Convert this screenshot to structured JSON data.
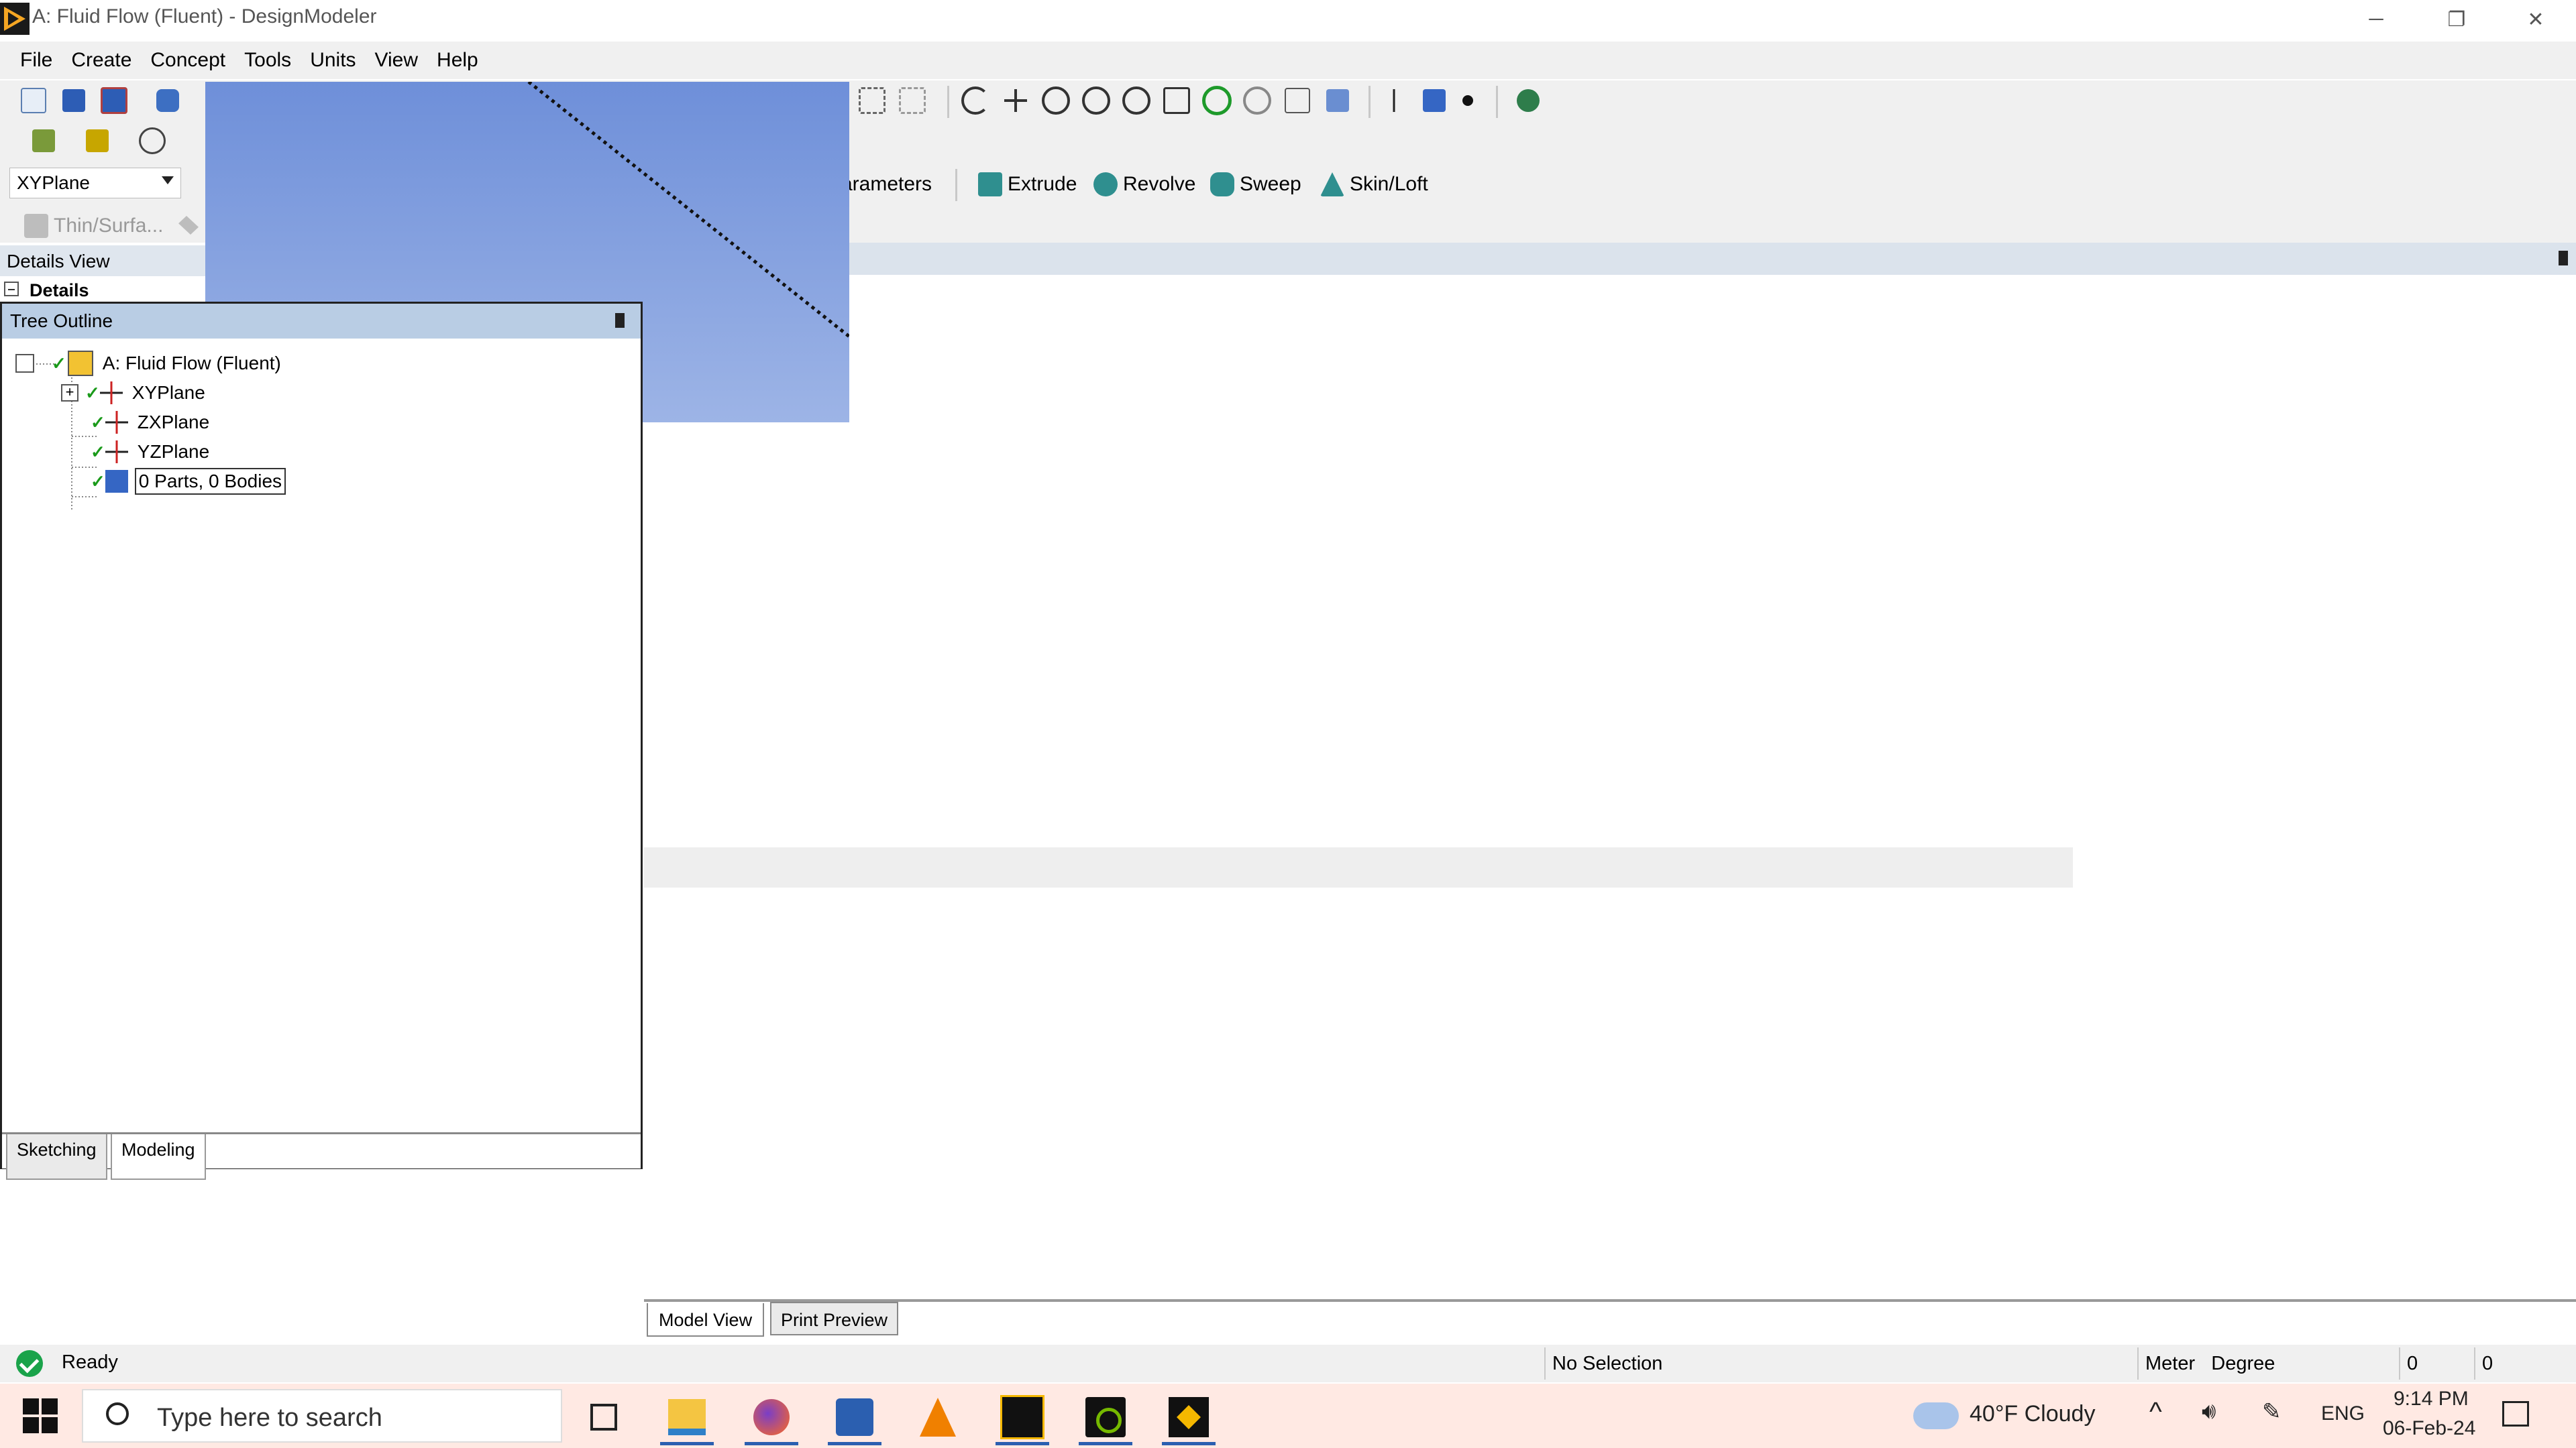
{
  "window": {
    "title": "A: Fluid Flow (Fluent) - DesignModeler",
    "minimize": "─",
    "restore": "❐",
    "close": "✕"
  },
  "menu": [
    "File",
    "Create",
    "Concept",
    "Tools",
    "Units",
    "View",
    "Help"
  ],
  "toolbar": {
    "plane_select": "XYPlane",
    "parameters_label": "arameters",
    "features": [
      "Extrude",
      "Revolve",
      "Sweep",
      "Skin/Loft"
    ],
    "thin_surface": "Thin/Surfa..."
  },
  "details": {
    "header": "Details View",
    "row": "Details"
  },
  "tree": {
    "header": "Tree Outline",
    "root": "A: Fluid Flow (Fluent)",
    "items": [
      "XYPlane",
      "ZXPlane",
      "YZPlane"
    ],
    "parts": "0 Parts, 0 Bodies",
    "tabs": [
      "Sketching",
      "Modeling"
    ]
  },
  "view_tabs": [
    "Model View",
    "Print Preview"
  ],
  "status": {
    "ready": "Ready",
    "selection": "No Selection",
    "units": "Meter   Degree",
    "val1": "0",
    "val2": "0"
  },
  "taskbar": {
    "search_placeholder": "Type here to search",
    "weather": "40°F  Cloudy",
    "lang": "ENG",
    "time": "9:14 PM",
    "date": "06-Feb-24",
    "apps": [
      "file-explorer",
      "firefox",
      "word",
      "vlc",
      "workbench",
      "nvidia",
      "mechanical"
    ]
  },
  "colors": {
    "viewport_top": "#6e8fd9",
    "viewport_bottom": "#9db4e6",
    "tree_header": "#b9cde4",
    "taskbar": "#ffe9e3"
  }
}
